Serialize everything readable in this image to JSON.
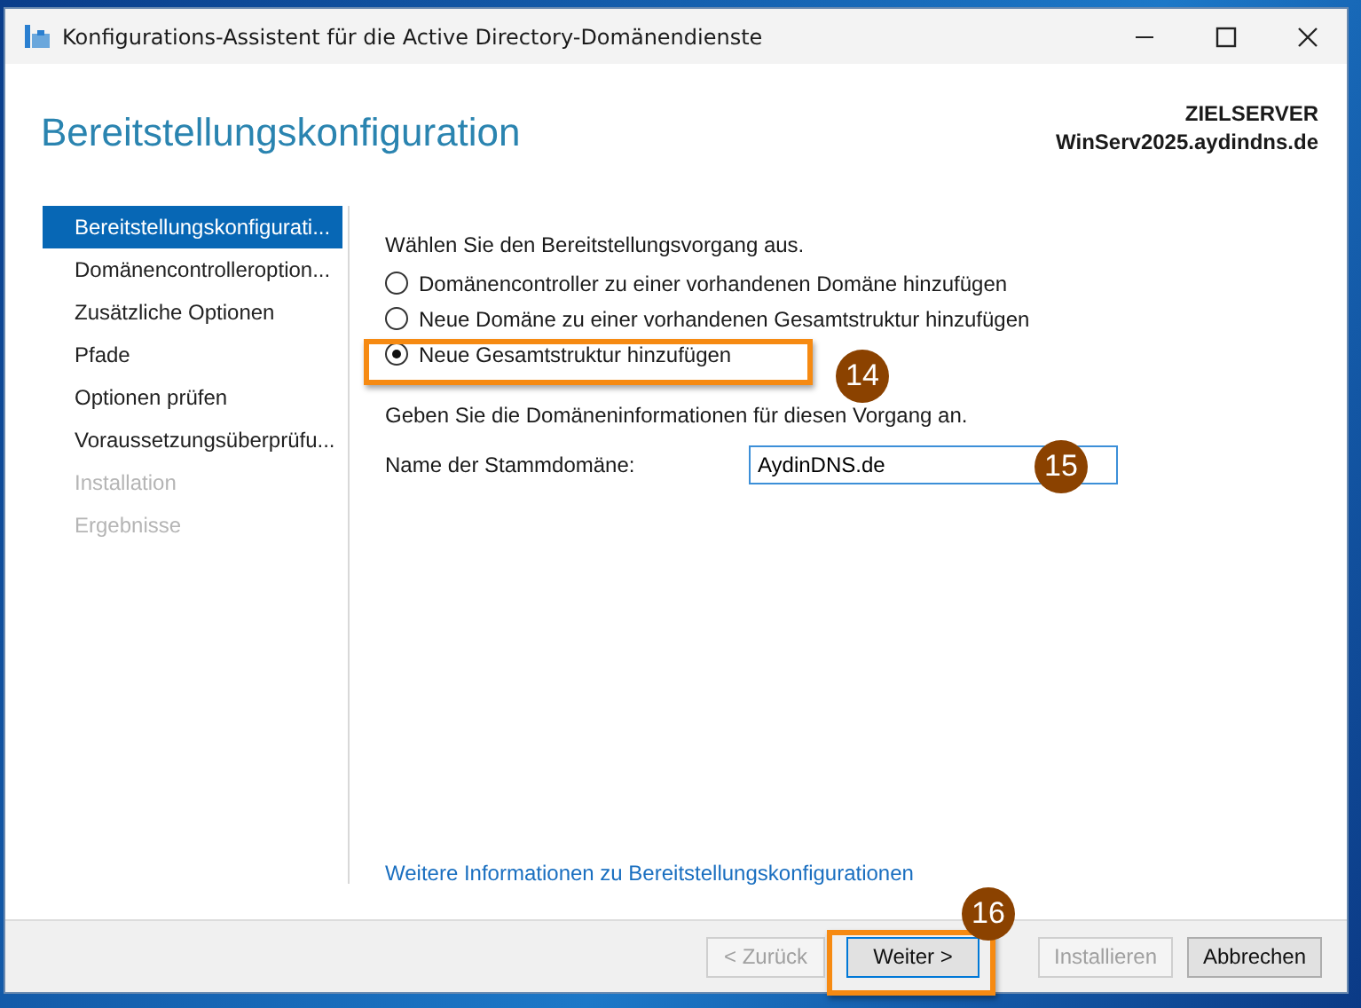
{
  "window": {
    "title": "Konfigurations-Assistent für die Active Directory-Domänendienste"
  },
  "header": {
    "title": "Bereitstellungskonfiguration",
    "server_label": "ZIELSERVER",
    "server_name": "WinServ2025.aydindns.de"
  },
  "sidebar": {
    "items": [
      {
        "label": "Bereitstellungskonfigurati...",
        "selected": true,
        "disabled": false
      },
      {
        "label": "Domänencontrolleroption...",
        "selected": false,
        "disabled": false
      },
      {
        "label": "Zusätzliche Optionen",
        "selected": false,
        "disabled": false
      },
      {
        "label": "Pfade",
        "selected": false,
        "disabled": false
      },
      {
        "label": "Optionen prüfen",
        "selected": false,
        "disabled": false
      },
      {
        "label": "Voraussetzungsüberprüfu...",
        "selected": false,
        "disabled": false
      },
      {
        "label": "Installation",
        "selected": false,
        "disabled": true
      },
      {
        "label": "Ergebnisse",
        "selected": false,
        "disabled": true
      }
    ]
  },
  "content": {
    "prompt": "Wählen Sie den Bereitstellungsvorgang aus.",
    "options": [
      {
        "label": "Domänencontroller zu einer vorhandenen Domäne hinzufügen",
        "selected": false
      },
      {
        "label": "Neue Domäne zu einer vorhandenen Gesamtstruktur hinzufügen",
        "selected": false
      },
      {
        "label": "Neue Gesamtstruktur hinzufügen",
        "selected": true
      }
    ],
    "domain_prompt": "Geben Sie die Domäneninformationen für diesen Vorgang an.",
    "root_domain_label": "Name der Stammdomäne:",
    "root_domain_value": "AydinDNS.de",
    "more_info_link": "Weitere Informationen zu Bereitstellungskonfigurationen"
  },
  "buttons": [
    {
      "label": "< Zurück",
      "disabled": true,
      "default": false
    },
    {
      "label": "Weiter >",
      "disabled": false,
      "default": true
    },
    {
      "label": "Installieren",
      "disabled": true,
      "default": false
    },
    {
      "label": "Abbrechen",
      "disabled": false,
      "default": false
    }
  ],
  "annotations": [
    {
      "label": "14"
    },
    {
      "label": "15"
    },
    {
      "label": "16"
    }
  ]
}
